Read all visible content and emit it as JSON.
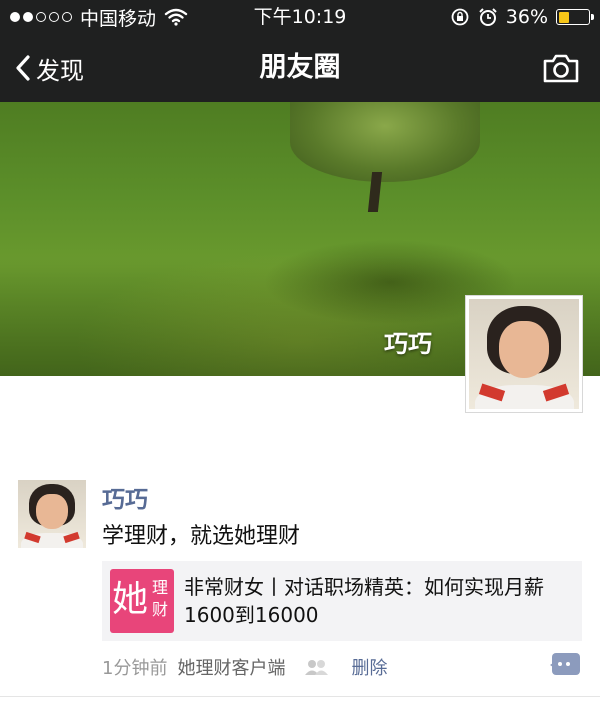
{
  "status_bar": {
    "carrier": "中国移动",
    "time": "下午10:19",
    "battery": "36%",
    "battery_level": 0.36,
    "battery_color": "#f5c518",
    "signal_bars_filled": 2,
    "signal_bars_total": 5,
    "icons": [
      "wifi-icon",
      "orientation-lock-icon",
      "alarm-icon",
      "battery-icon"
    ]
  },
  "nav": {
    "back_label": "发现",
    "title": "朋友圈",
    "icons": [
      "chevron-left-icon",
      "camera-icon"
    ]
  },
  "cover": {
    "username": "巧巧"
  },
  "post": {
    "author": "巧巧",
    "text": "学理财，就选她理财",
    "link": {
      "thumb_big": "她",
      "thumb_small": "理财",
      "title": "非常财女丨对话职场精英：如何实现月薪1600到16000"
    },
    "time": "1分钟前",
    "source": "她理财客户端",
    "delete_label": "删除",
    "icons": [
      "privacy-icon",
      "comment-icon"
    ]
  },
  "colors": {
    "bar_background": "#1f2020",
    "link_blue": "#576b95",
    "thumb_pink": "#e8457a"
  }
}
